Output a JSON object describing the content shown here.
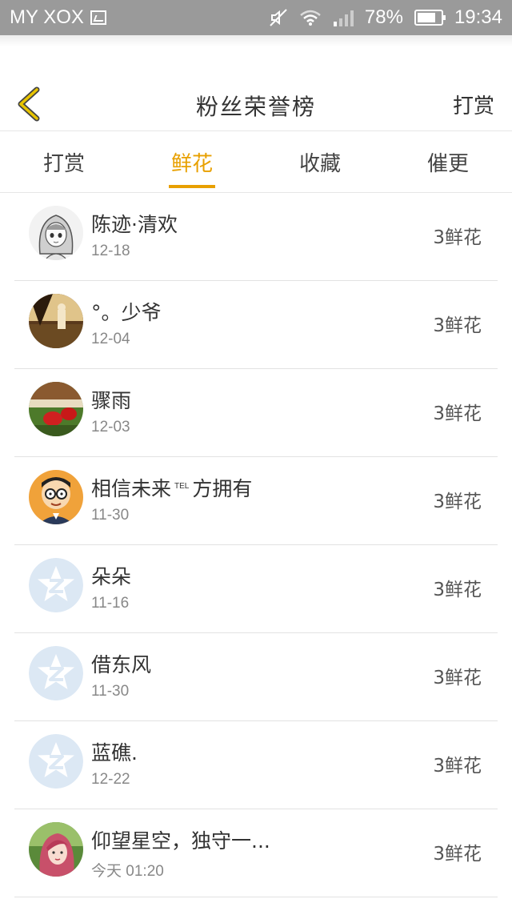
{
  "status_bar": {
    "carrier": "MY XOX",
    "battery": "78%",
    "battery_level": 0.78,
    "time": "19:34"
  },
  "nav": {
    "title": "粉丝荣誉榜",
    "right_action": "打赏"
  },
  "tabs": [
    {
      "label": "打赏",
      "active": false
    },
    {
      "label": "鲜花",
      "active": true
    },
    {
      "label": "收藏",
      "active": false
    },
    {
      "label": "催更",
      "active": false
    }
  ],
  "fans": [
    {
      "name": "陈迹·清欢",
      "date": "12-18",
      "count": "3鲜花",
      "avatar": "sketch-girl-avatar"
    },
    {
      "name": "°。少爷",
      "date": "12-04",
      "count": "3鲜花",
      "avatar": "photo-avatar"
    },
    {
      "name": "骤雨",
      "date": "12-03",
      "count": "3鲜花",
      "avatar": "photo-avatar"
    },
    {
      "name_pre": "相信未来",
      "name_sup": "TEL",
      "name_post": "方拥有",
      "date": "11-30",
      "count": "3鲜花",
      "avatar": "cartoon-avatar"
    },
    {
      "name": "朵朵",
      "date": "11-16",
      "count": "3鲜花",
      "avatar": "default-star-avatar"
    },
    {
      "name": "借东风",
      "date": "11-30",
      "count": "3鲜花",
      "avatar": "default-star-avatar"
    },
    {
      "name": "蓝礁.",
      "date": "12-22",
      "count": "3鲜花",
      "avatar": "default-star-avatar"
    },
    {
      "name": "仰望星空，独守一...",
      "date": "今天 01:20",
      "count": "3鲜花",
      "avatar": "photo-avatar"
    }
  ],
  "colors": {
    "accent": "#e8a000",
    "back_arrow": "#e8c400",
    "status_bar_bg": "#9a9a9a",
    "default_avatar": "#dce8f4"
  }
}
